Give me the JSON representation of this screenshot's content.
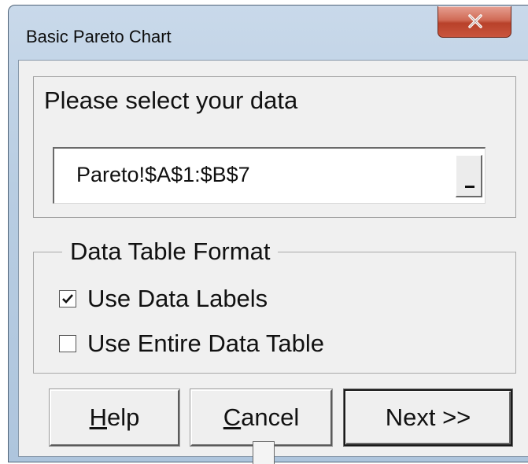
{
  "window": {
    "title": "Basic Pareto Chart",
    "close_icon": "close-x-icon"
  },
  "data_selection": {
    "heading": "Please select your data",
    "range_value": "Pareto!$A$1:$B$7",
    "range_button_icon": "collapse-dialog-icon"
  },
  "data_table_format": {
    "legend": "Data Table Format",
    "options": [
      {
        "label": "Use Data Labels",
        "checked": true
      },
      {
        "label": "Use Entire Data Table",
        "checked": false
      }
    ]
  },
  "buttons": {
    "help": {
      "mnemonic": "H",
      "rest": "elp"
    },
    "cancel": {
      "mnemonic": "C",
      "rest": "ancel"
    },
    "next": "Next >>"
  },
  "colors": {
    "close_button": "#c9553d",
    "dialog_background": "#f0f0f0",
    "frame": "#b8cde2"
  }
}
